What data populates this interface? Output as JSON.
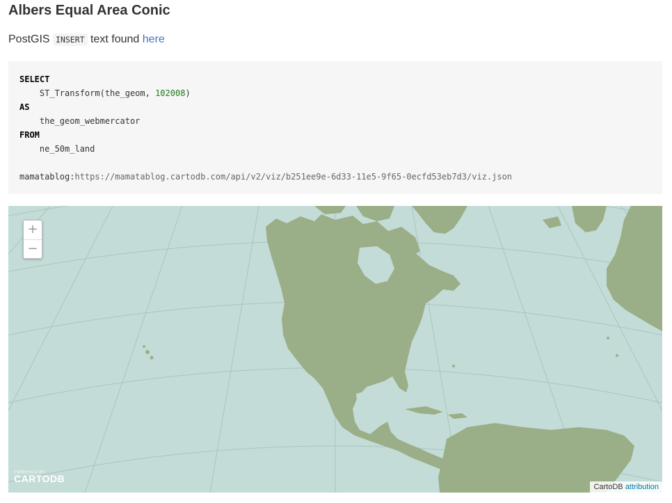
{
  "title": "Albers Equal Area Conic",
  "intro": {
    "prefix": "PostGIS",
    "code": "INSERT",
    "middle": "text found",
    "link": "here"
  },
  "code": {
    "select": "SELECT",
    "transform_fn": "    ST_Transform(the_geom, ",
    "srid": "102008",
    "transform_close": ")",
    "as": "AS",
    "alias": "    the_geom_webmercator",
    "from": "FROM",
    "table": "    ne_50m_land",
    "viz_user": "mamatablog",
    "viz_url": "https://mamatablog.cartodb.com/api/v2/viz/b251ee9e-6d33-11e5-9f65-0ecfd53eb7d3/viz.json"
  },
  "map": {
    "zoom_in": "+",
    "zoom_out": "−",
    "logo_powered": "POWERED BY",
    "logo_brand": "CARTODB",
    "attribution_prefix": "CartoDB",
    "attribution_link": "attribution",
    "ocean_color": "#c3dcd7",
    "land_color": "#9aae87",
    "graticule_color": "#a9c4bf"
  }
}
